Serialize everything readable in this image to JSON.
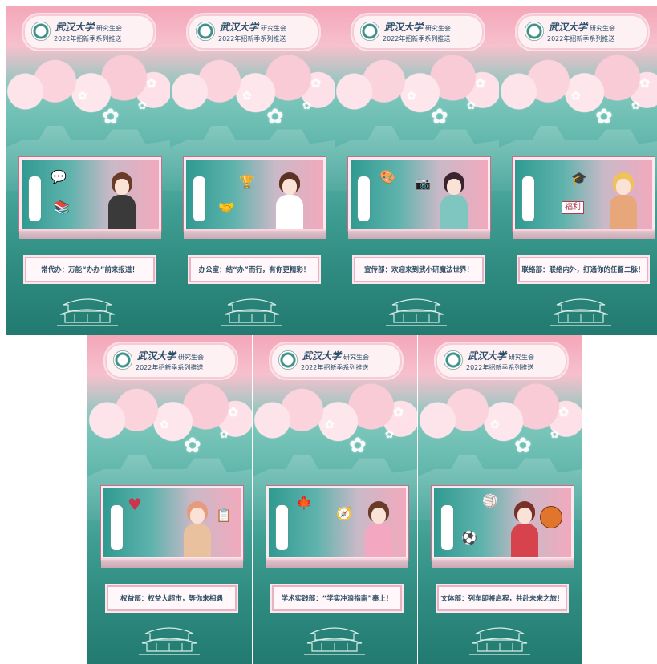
{
  "common": {
    "university": "武汉大学",
    "union": "研究生会",
    "series": "2022年招新季系列推送"
  },
  "posters": [
    {
      "caption": "常代办：万能“办办”前来报道！",
      "prop1": "💬",
      "prop2": "📚",
      "hair": "#6b3b2a",
      "body": "#3a3a3a"
    },
    {
      "caption": "办公室：结“办”而行，有你更精彩！",
      "prop1": "🏆",
      "prop2": "🤝",
      "hair": "#5a3325",
      "body": "#ffffff"
    },
    {
      "caption": "宣传部：欢迎来到武小研魔法世界！",
      "prop1": "📷",
      "prop2": "🎨",
      "hair": "#3b2330",
      "body": "#7fc6c0"
    },
    {
      "caption": "联络部：联络内外，打通你的任督二脉！",
      "prop1": "🎓",
      "prop2": "福利",
      "hair": "#f1c15a",
      "body": "#e7a77a"
    },
    {
      "caption": "权益部：权益大超市，等你来相遇",
      "prop1": "♥",
      "prop2": "📋",
      "hair": "#e89a7e",
      "body": "#e9c19e"
    },
    {
      "caption": "学术实践部：“学实冲浪指南”奉上！",
      "prop1": "🍁",
      "prop2": "🧭",
      "hair": "#6b3b2a",
      "body": "#f4a7c0"
    },
    {
      "caption": "文体部：列车即将启程，共赴未来之旅！",
      "prop1": "🏐",
      "prop2": "⚽",
      "hair": "#7b2f2a",
      "body": "#d6434d"
    }
  ]
}
